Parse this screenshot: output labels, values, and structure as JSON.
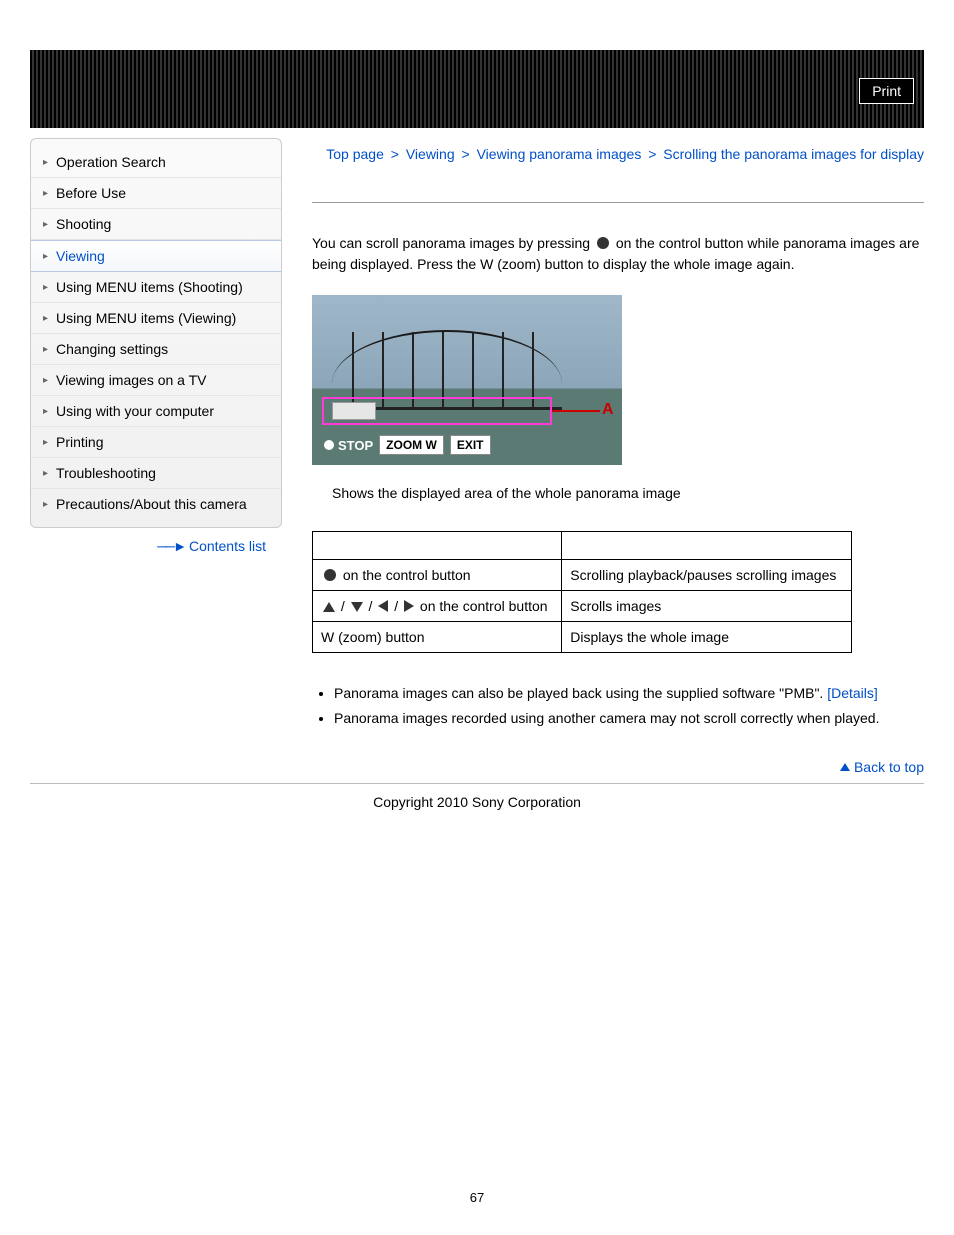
{
  "header": {
    "print": "Print"
  },
  "sidebar": {
    "items": [
      {
        "label": "Operation Search"
      },
      {
        "label": "Before Use"
      },
      {
        "label": "Shooting"
      },
      {
        "label": "Viewing",
        "active": true
      },
      {
        "label": "Using MENU items (Shooting)"
      },
      {
        "label": "Using MENU items (Viewing)"
      },
      {
        "label": "Changing settings"
      },
      {
        "label": "Viewing images on a TV"
      },
      {
        "label": "Using with your computer"
      },
      {
        "label": "Printing"
      },
      {
        "label": "Troubleshooting"
      },
      {
        "label": "Precautions/About this camera"
      }
    ],
    "contents_list": "Contents list"
  },
  "breadcrumb": {
    "top": "Top page",
    "sep": ">",
    "l1": "Viewing",
    "l2": "Viewing panorama images",
    "current": "Scrolling the panorama images for display"
  },
  "body": {
    "para1a": "You can scroll panorama images by pressing",
    "para1b": "on the control button while panorama images are being displayed. Press the W (zoom) button to display the whole image again.",
    "osd": {
      "stop": "STOP",
      "zoom": "ZOOM W",
      "exit": "EXIT",
      "label": "A"
    },
    "caption": "Shows the displayed area of the whole panorama image"
  },
  "table": {
    "rows": [
      {
        "icon": "dot",
        "control": "on the control button",
        "action": "Scrolling playback/pauses scrolling images"
      },
      {
        "icon": "arrows",
        "control": "on the control button",
        "action": "Scrolls images"
      },
      {
        "icon": "none",
        "control": "W (zoom) button",
        "action": "Displays the whole image"
      }
    ]
  },
  "notes": {
    "n1a": "Panorama images can also be played back using the supplied software \"PMB\".",
    "n1b": "[Details]",
    "n2": "Panorama images recorded using another camera may not scroll correctly when played."
  },
  "footer": {
    "back": "Back to top",
    "copyright": "Copyright 2010 Sony Corporation",
    "page": "67"
  }
}
